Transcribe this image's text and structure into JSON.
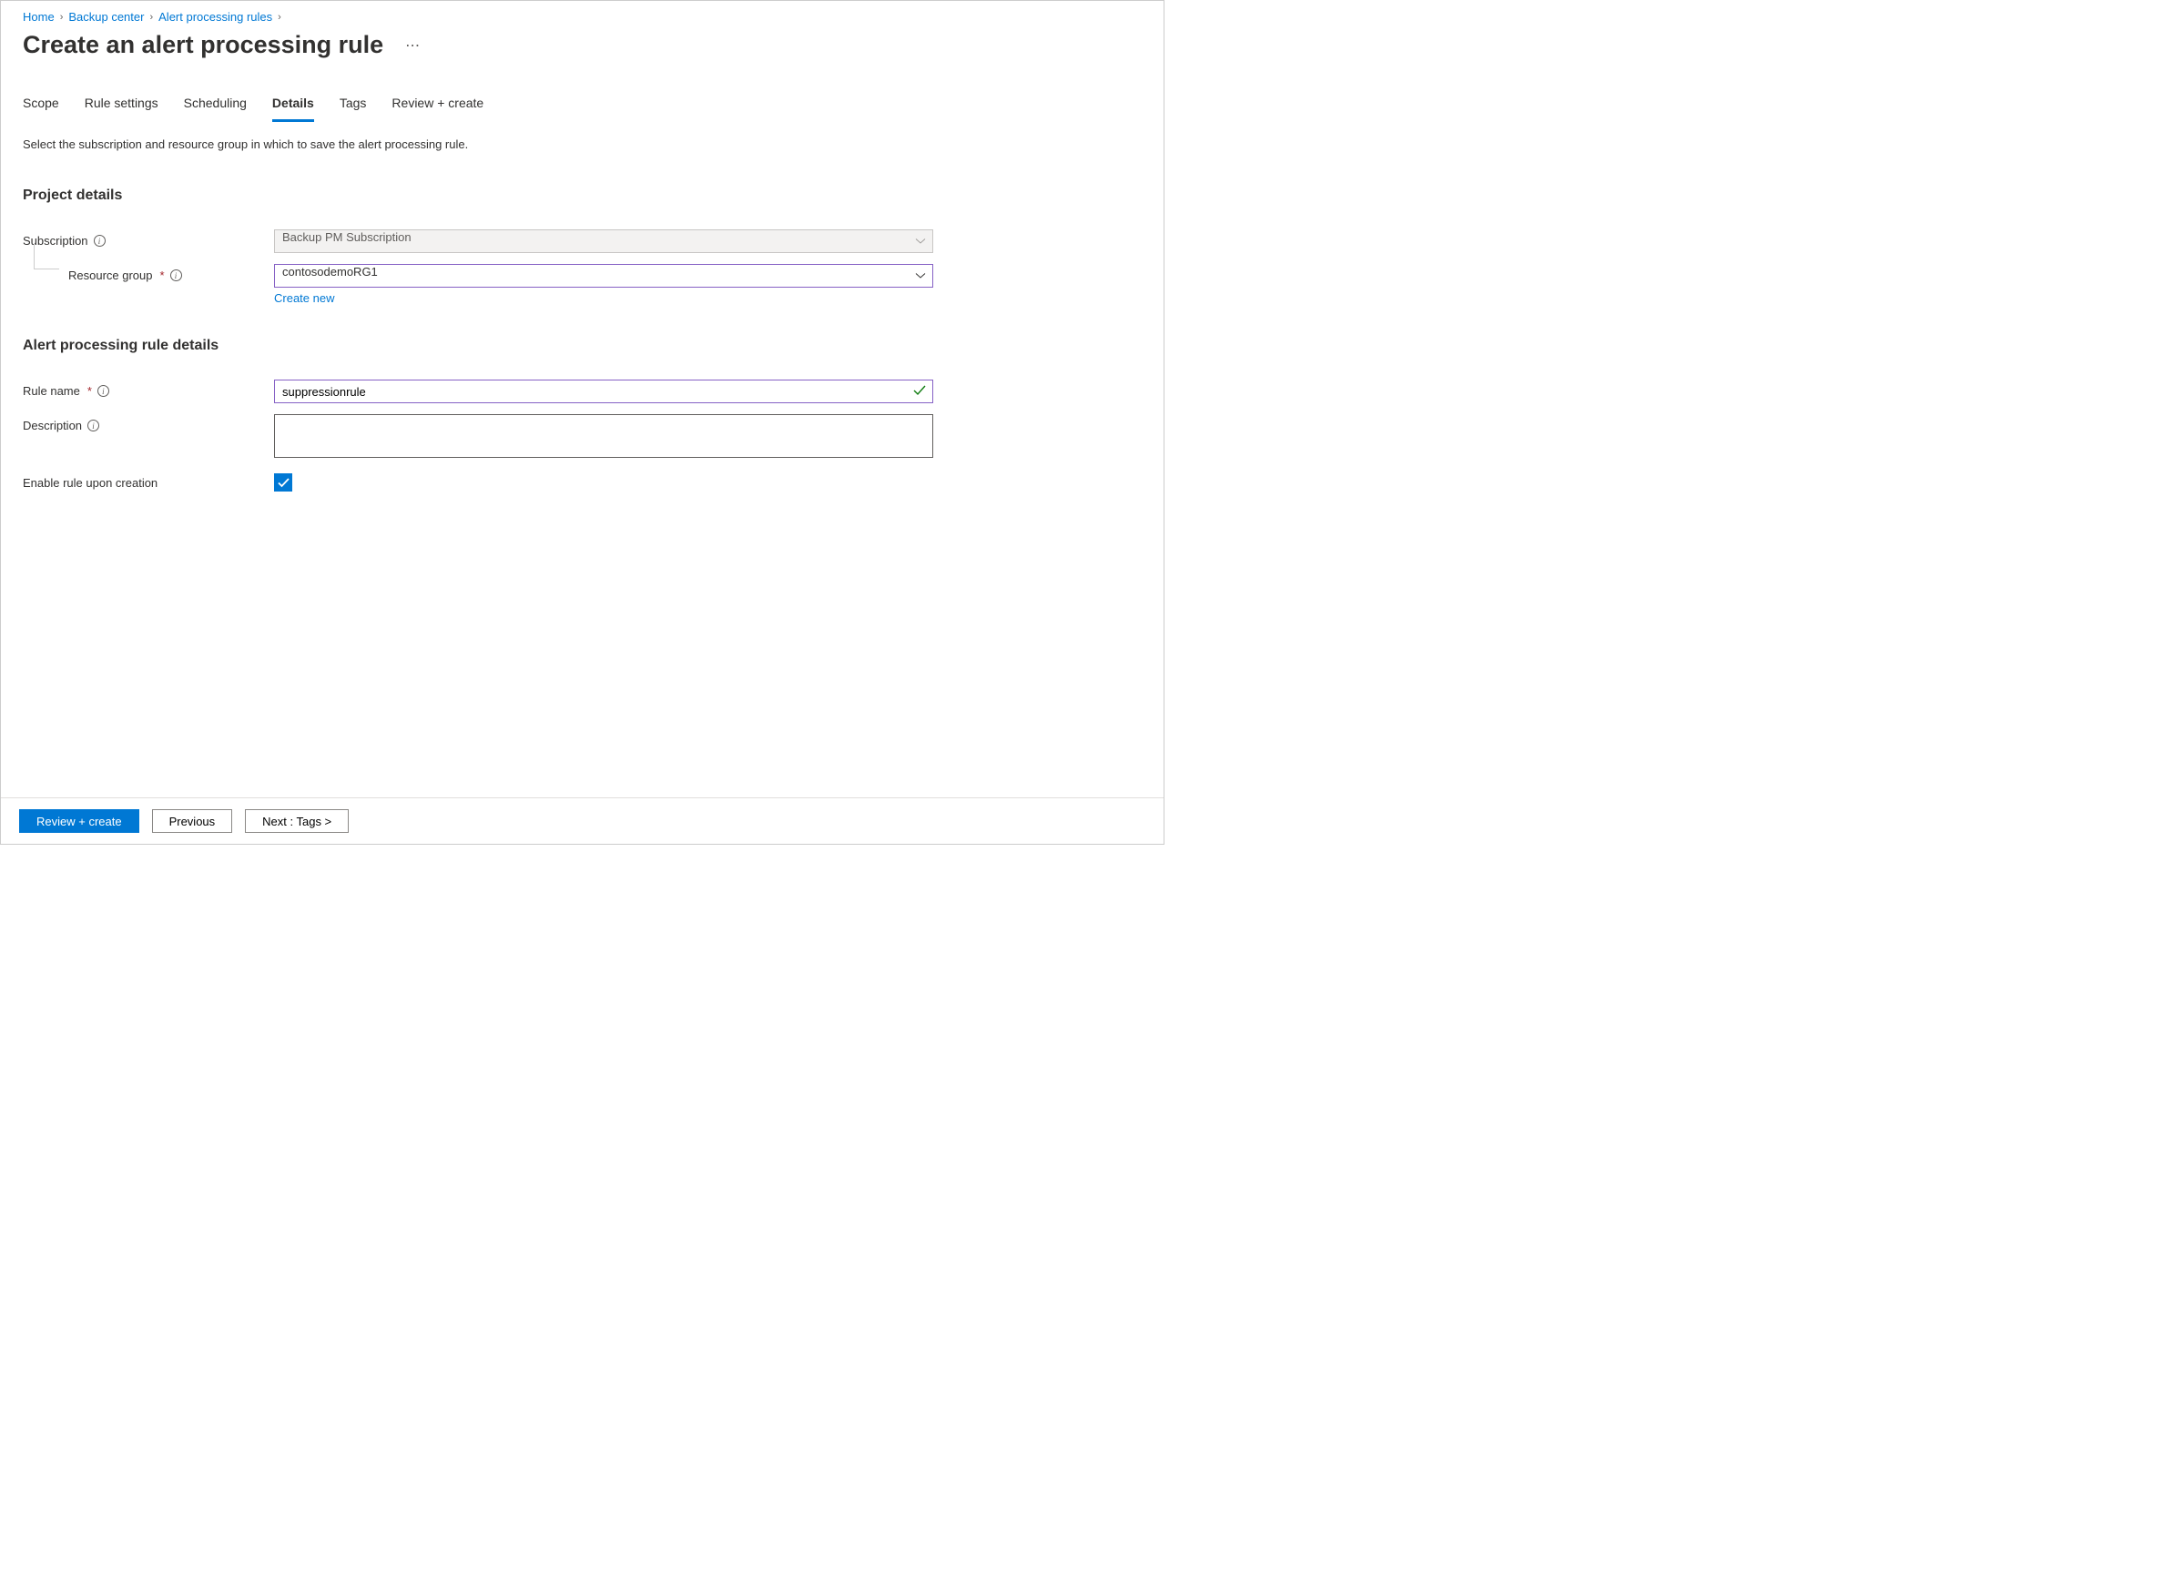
{
  "breadcrumb": {
    "items": [
      "Home",
      "Backup center",
      "Alert processing rules"
    ]
  },
  "page_title": "Create an alert processing rule",
  "tabs": [
    "Scope",
    "Rule settings",
    "Scheduling",
    "Details",
    "Tags",
    "Review + create"
  ],
  "active_tab_index": 3,
  "description": "Select the subscription and resource group in which to save the alert processing rule.",
  "section1": {
    "heading": "Project details",
    "subscription": {
      "label": "Subscription",
      "value": "Backup PM Subscription"
    },
    "resource_group": {
      "label": "Resource group",
      "value": "contosodemoRG1",
      "create_new": "Create new"
    }
  },
  "section2": {
    "heading": "Alert processing rule details",
    "rule_name": {
      "label": "Rule name",
      "value": "suppressionrule"
    },
    "descr": {
      "label": "Description",
      "value": ""
    },
    "enable": {
      "label": "Enable rule upon creation",
      "checked": true
    }
  },
  "footer": {
    "review": "Review + create",
    "previous": "Previous",
    "next": "Next : Tags >"
  }
}
